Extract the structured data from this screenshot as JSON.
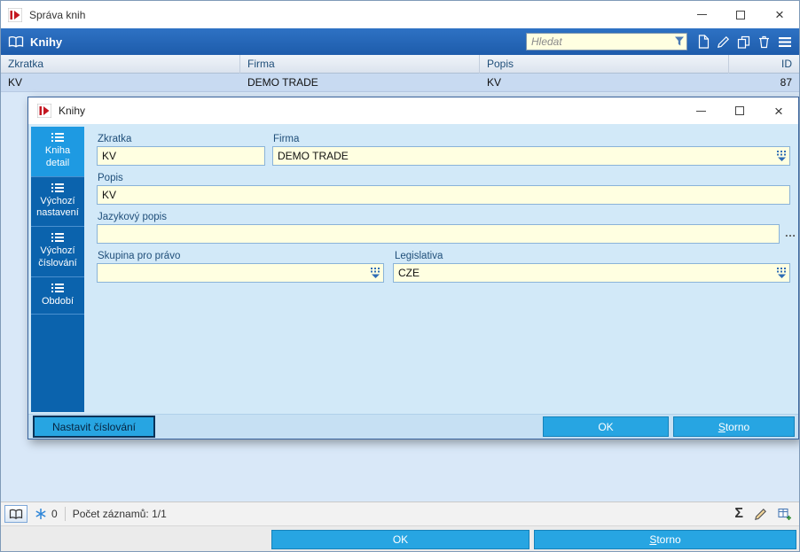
{
  "icons": {
    "close_glyph": "×",
    "ellipsis": "…",
    "sigma": "Σ"
  },
  "main_window": {
    "title": "Správa knih",
    "header": {
      "title": "Knihy",
      "search_placeholder": "Hledat"
    },
    "table": {
      "columns": [
        "Zkratka",
        "Firma",
        "Popis",
        "ID"
      ],
      "rows": [
        {
          "zkratka": "KV",
          "firma": "DEMO TRADE",
          "popis": "KV",
          "id": "87"
        }
      ]
    },
    "statusbar": {
      "counter": "0",
      "records": "Počet záznamů: 1/1"
    },
    "footer": {
      "ok": "OK",
      "storno": "Storno"
    }
  },
  "dialog": {
    "title": "Knihy",
    "tabs": [
      {
        "label": "Kniha detail"
      },
      {
        "label": "Výchozí nastavení"
      },
      {
        "label": "Výchozí číslování"
      },
      {
        "label": "Období"
      }
    ],
    "fields": {
      "zkratka": {
        "label": "Zkratka",
        "value": "KV"
      },
      "firma": {
        "label": "Firma",
        "value": "DEMO TRADE"
      },
      "popis": {
        "label": "Popis",
        "value": "KV"
      },
      "jazykovy_popis": {
        "label": "Jazykový popis",
        "value": ""
      },
      "skupina_pro_pravo": {
        "label": "Skupina pro právo",
        "value": ""
      },
      "legislativa": {
        "label": "Legislativa",
        "value": "CZE"
      }
    },
    "buttons": {
      "nastavit": "Nastavit číslování",
      "ok": "OK",
      "storno": "Storno"
    }
  }
}
